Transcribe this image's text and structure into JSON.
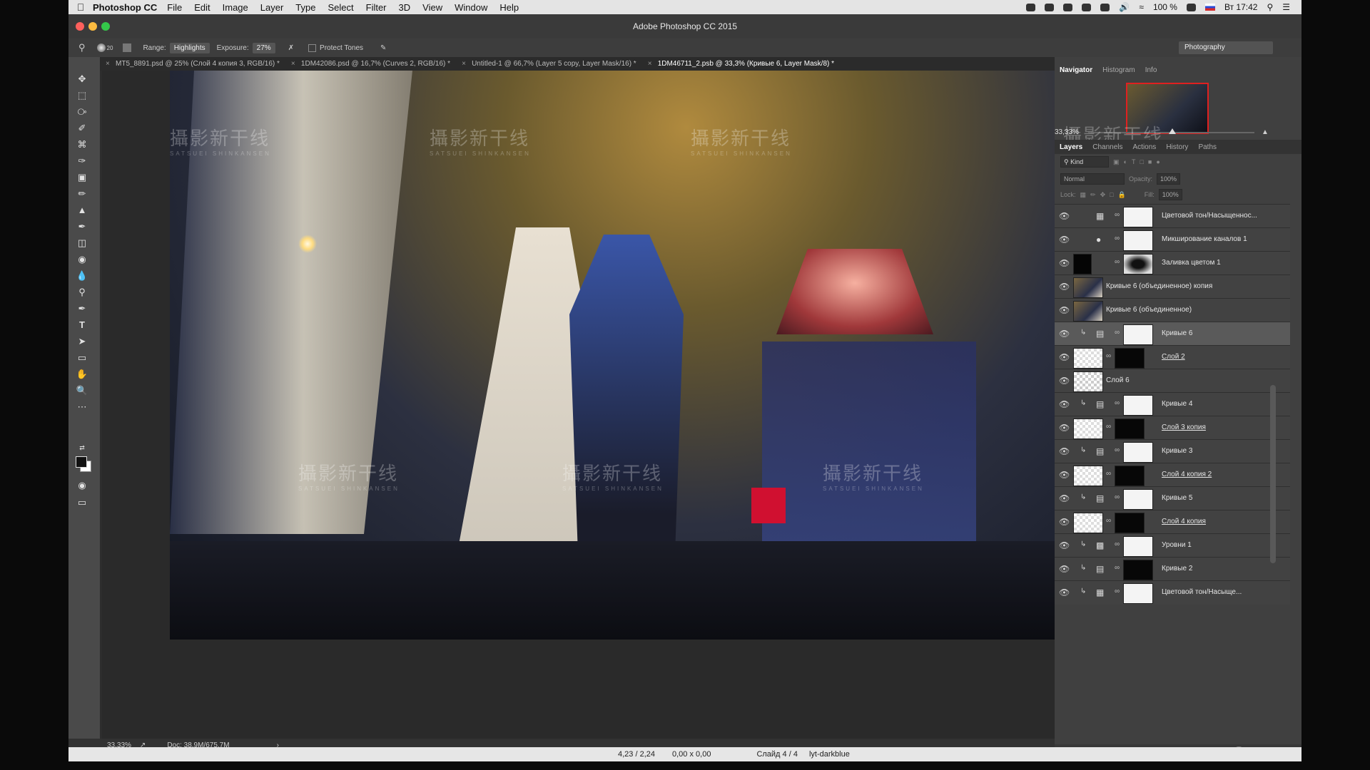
{
  "menubar": {
    "app_name": "Photoshop CC",
    "items": [
      "File",
      "Edit",
      "Image",
      "Layer",
      "Type",
      "Select",
      "Filter",
      "3D",
      "View",
      "Window",
      "Help"
    ],
    "battery": "100 %",
    "clock": "Вт 17:42"
  },
  "window": {
    "title": "Adobe Photoshop CC 2015"
  },
  "options": {
    "brush_size": "20",
    "range_label": "Range:",
    "range_value": "Highlights",
    "exposure_label": "Exposure:",
    "exposure_value": "27%",
    "protect_tones": "Protect Tones",
    "workspace": "Photography"
  },
  "tabs": [
    {
      "label": "MT5_8891.psd @ 25% (Слой 4 копия 3, RGB/16) *"
    },
    {
      "label": "1DM42086.psd @ 16,7% (Curves 2, RGB/16) *"
    },
    {
      "label": "Untitled-1 @ 66,7% (Layer 5 copy, Layer Mask/16) *"
    },
    {
      "label": "1DM46711_2.psb @ 33,3% (Кривые 6, Layer Mask/8) *"
    }
  ],
  "watermark": {
    "text": "攝影新干线",
    "sub": "SATSUEI SHINKANSEN",
    "edge_left": "干线",
    "edge_left_sub": "HINKANSEN"
  },
  "docstatus": {
    "zoom": "33,33%",
    "doc": "Doc: 38,9M/675,7M"
  },
  "panels": {
    "nav_tabs": [
      "Navigator",
      "Histogram",
      "Info"
    ],
    "nav_zoom": "33,33%",
    "layer_tabs": [
      "Layers",
      "Channels",
      "Actions",
      "History",
      "Paths"
    ],
    "kind_label": "Kind",
    "blend_mode": "Normal",
    "opacity_label": "Opacity:",
    "opacity_value": "100%",
    "lock_label": "Lock:",
    "fill_label": "Fill:",
    "fill_value": "100%"
  },
  "layers": [
    {
      "name": "Цветовой тон/Насыщеннос...",
      "type": "adj",
      "icon": "hue-sat",
      "mask": "white",
      "clip": false
    },
    {
      "name": "Микширование каналов 1",
      "type": "adj",
      "icon": "channel-mixer",
      "mask": "white",
      "clip": false
    },
    {
      "name": "Заливка цветом 1",
      "type": "fill",
      "icon": "black-fill",
      "mask": "blur",
      "clip": false
    },
    {
      "name": "Кривые 6 (объединенное) копия",
      "type": "pixel",
      "icon": "photo"
    },
    {
      "name": "Кривые 6 (объединенное)",
      "type": "pixel",
      "icon": "photo"
    },
    {
      "name": "Кривые 6",
      "type": "adj",
      "icon": "curves",
      "mask": "white",
      "clip": true,
      "selected": true
    },
    {
      "name": "Слой 2",
      "type": "pixel-mask",
      "icon": "figure",
      "mask": "black",
      "underline": true
    },
    {
      "name": "Слой 6",
      "type": "pixel",
      "icon": "checker"
    },
    {
      "name": "Кривые 4",
      "type": "adj",
      "icon": "curves",
      "mask": "white",
      "clip": true
    },
    {
      "name": "Слой 3 копия",
      "type": "pixel-mask",
      "icon": "figure",
      "mask": "black",
      "underline": true
    },
    {
      "name": "Кривые 3",
      "type": "adj",
      "icon": "curves",
      "mask": "white",
      "clip": true
    },
    {
      "name": "Слой 4 копия 2",
      "type": "pixel-mask",
      "icon": "figure",
      "mask": "black",
      "underline": true
    },
    {
      "name": "Кривые 5",
      "type": "adj",
      "icon": "curves",
      "mask": "white",
      "clip": true
    },
    {
      "name": "Слой 4 копия",
      "type": "pixel-mask",
      "icon": "figure",
      "mask": "black",
      "underline": true
    },
    {
      "name": "Уровни 1",
      "type": "adj",
      "icon": "levels",
      "mask": "white",
      "clip": true
    },
    {
      "name": "Кривые 2",
      "type": "adj",
      "icon": "curves",
      "mask": "black",
      "clip": true
    },
    {
      "name": "Цветовой тон/Насыще...",
      "type": "adj",
      "icon": "hue-sat",
      "mask": "white",
      "clip": true
    }
  ],
  "appstatus": {
    "coords": "4,23 / 2,24",
    "size": "0,00 x 0,00",
    "slide": "Слайд 4 / 4",
    "theme": "lyt-darkblue"
  }
}
